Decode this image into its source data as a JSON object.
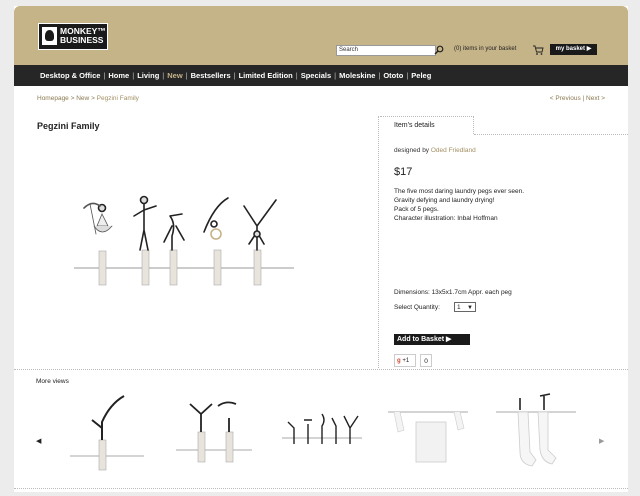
{
  "header": {
    "logo_line1": "MONKEY™",
    "logo_line2": "BUSINESS",
    "search_placeholder": "Search",
    "basket_status": "(0) items in your basket",
    "my_basket": "my basket ▶"
  },
  "nav": {
    "items": [
      "Desktop & Office",
      "Home",
      "Living",
      "New",
      "Bestsellers",
      "Limited Edition",
      "Specials",
      "Moleskine",
      "Ototo",
      "Peleg"
    ],
    "active_index": 3
  },
  "breadcrumb": {
    "home": "Homepage",
    "sep1": ">",
    "section": "New",
    "sep2": ">",
    "current": "Pegzini Family"
  },
  "pager": {
    "prev": "< Previous",
    "sep": "|",
    "next": "Next >"
  },
  "product": {
    "title": "Pegzini Family",
    "tab": "Item's details",
    "designed_by": "designed by",
    "designer": "Oded Friedland",
    "price": "$17",
    "desc": [
      "The five most daring laundry pegs ever seen.",
      "Gravity defying and laundry drying!",
      "Pack of 5 pegs.",
      "Character illustration: Inbal Hoffman"
    ],
    "dimensions": "Dimensions: 13x5x1.7cm Appr. each peg",
    "qty_label": "Select Quantity:",
    "qty_value": "1",
    "add_label": "Add to Basket ▶",
    "gplus": "+1",
    "gplus_count": "0"
  },
  "more_views": {
    "label": "More views",
    "left_arrow": "◀",
    "right_arrow": "▶"
  },
  "colors": {
    "header_bg": "#c6b489",
    "nav_bg": "#262626",
    "accent": "#a38f63"
  },
  "icons": [
    "search-icon",
    "cart-icon",
    "google-plus-icon"
  ]
}
